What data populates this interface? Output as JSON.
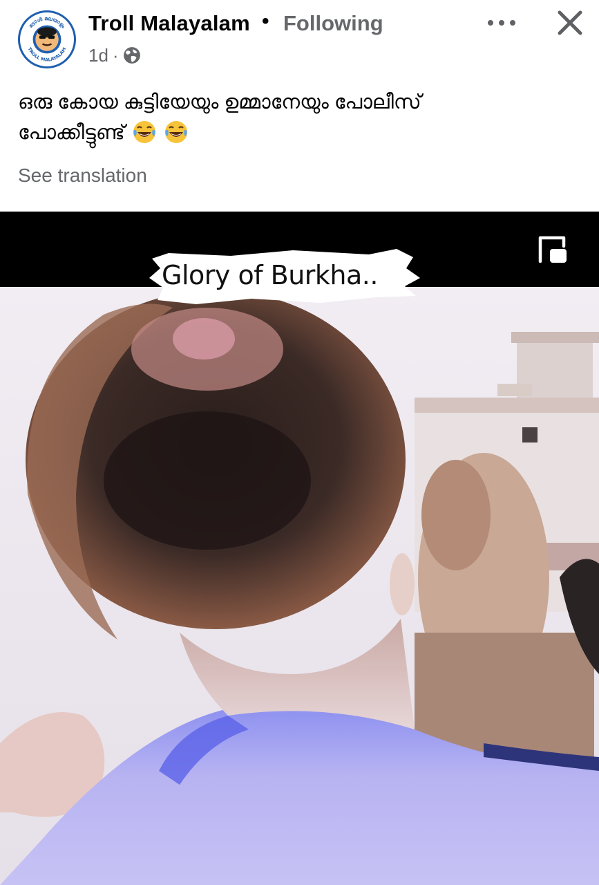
{
  "post": {
    "page_name": "Troll Malayalam",
    "separator": "•",
    "follow_status": "Following",
    "time": "1d",
    "meta_separator": "·",
    "audience_icon": "globe-icon",
    "text_line_1": "ഒരു കോയ കുട്ടിയേയും ഉമ്മാനേയും പോലീസ്",
    "text_line_2": "പോക്കീട്ടുണ്ട്",
    "emojis": [
      "face-with-tears-of-joy",
      "face-with-tears-of-joy"
    ],
    "see_translation": "See translation",
    "avatar_ring_text_top": "ട്രോൾ മലയാളം",
    "avatar_ring_text_bottom": "TROLL MALAYALAM"
  },
  "actions": {
    "more_icon": "more-options-icon",
    "close_icon": "close-icon"
  },
  "media": {
    "caption": "Glory of Burkha..",
    "pip_icon": "picture-in-picture-icon"
  }
}
